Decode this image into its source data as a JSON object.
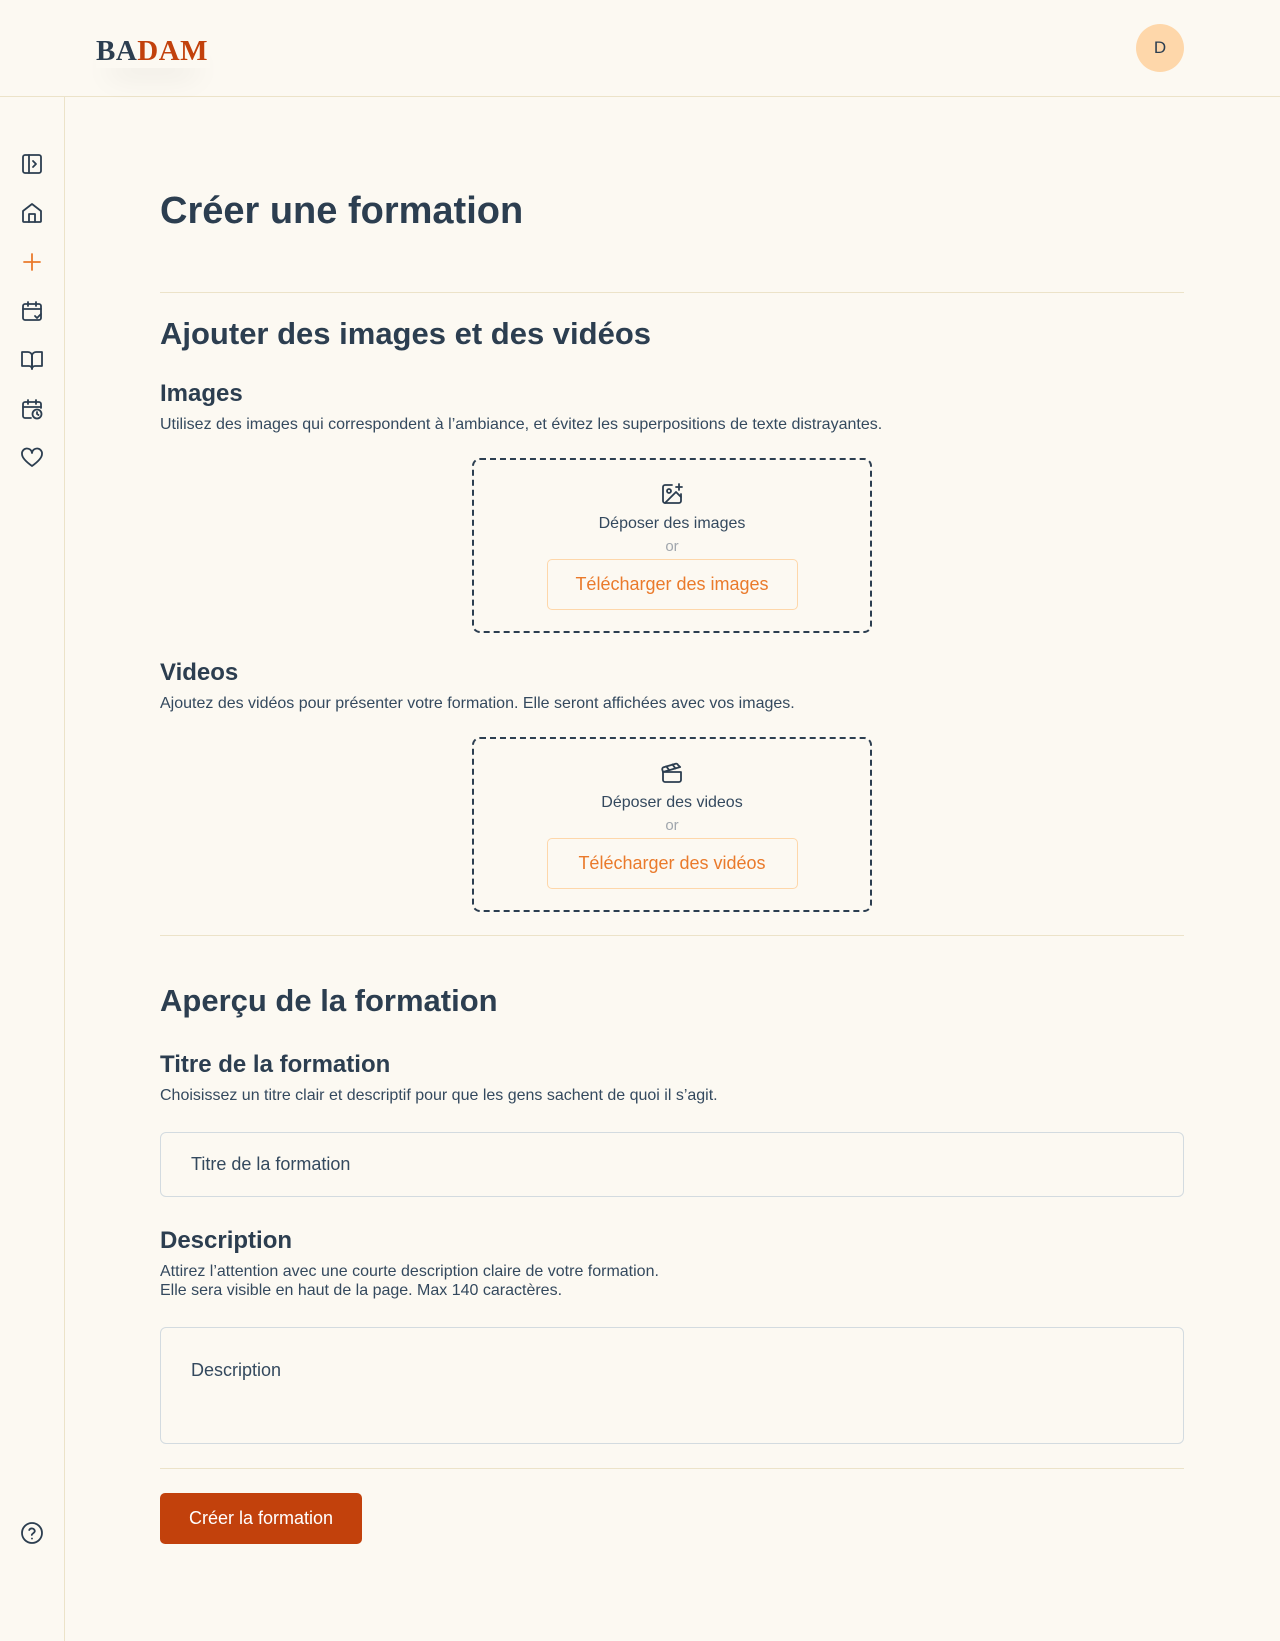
{
  "header": {
    "logo_part1": "BA",
    "logo_part2": "DAM",
    "avatar_initial": "D"
  },
  "sidebar": {
    "items": [
      {
        "icon": "sidebar-toggle-icon"
      },
      {
        "icon": "home-icon"
      },
      {
        "icon": "plus-icon"
      },
      {
        "icon": "calendar-check-icon"
      },
      {
        "icon": "book-open-icon"
      },
      {
        "icon": "calendar-clock-icon"
      },
      {
        "icon": "heart-icon"
      }
    ],
    "help_icon": "help-circle-icon"
  },
  "page": {
    "title": "Créer une formation"
  },
  "media": {
    "section_title": "Ajouter des images et des vidéos",
    "images": {
      "title": "Images",
      "hint": "Utilisez des images qui correspondent à l’ambiance, et évitez les superpositions de texte distrayantes.",
      "drop_label": "Déposer des images",
      "or": "or",
      "upload_label": "Télécharger des images"
    },
    "videos": {
      "title": "Videos",
      "hint": "Ajoutez des vidéos pour présenter votre formation. Elle seront affichées avec vos images.",
      "drop_label": "Déposer des videos",
      "or": "or",
      "upload_label": "Télécharger des vidéos"
    }
  },
  "overview": {
    "section_title": "Aperçu de la formation",
    "title_field": {
      "label": "Titre de la formation",
      "hint": "Choisissez un titre clair et descriptif pour que les gens sachent de quoi il s’agit.",
      "placeholder": "Titre de la formation"
    },
    "description_field": {
      "label": "Description",
      "hint_line1": "Attirez l’attention avec une courte description claire de votre formation.",
      "hint_line2": "Elle sera visible en haut de la page. Max 140 caractères.",
      "placeholder": "Description"
    }
  },
  "actions": {
    "create_label": "Créer la formation"
  },
  "colors": {
    "background": "#fcf9f2",
    "text": "#2c3e50",
    "accent": "#c2410c",
    "accent_light": "#ea7a2b",
    "avatar_bg": "#fed7aa"
  }
}
